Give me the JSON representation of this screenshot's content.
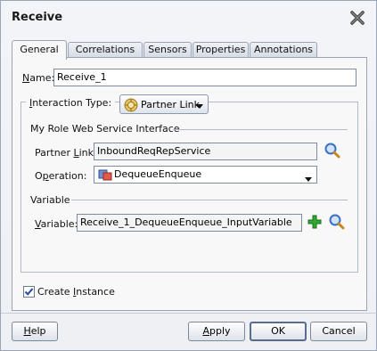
{
  "window": {
    "title": "Receive"
  },
  "tabs": [
    {
      "label": "General",
      "active": true
    },
    {
      "label": "Correlations"
    },
    {
      "label": "Sensors"
    },
    {
      "label": "Properties"
    },
    {
      "label": "Annotations"
    }
  ],
  "name": {
    "label_first": "N",
    "label_rest": "ame:",
    "value": "Receive_1"
  },
  "interaction": {
    "label_first": "I",
    "label_rest": "nteraction Type:",
    "value": "Partner Link",
    "icon": "partner-link-icon"
  },
  "role_section": {
    "title": "My Role Web Service Interface"
  },
  "partner_link": {
    "label_pre": "Partner ",
    "label_u": "L",
    "label_post": "ink:",
    "value": "InboundReqRepService"
  },
  "operation": {
    "label_pre": "O",
    "label_u": "p",
    "label_post": "eration:",
    "value": "DequeueEnqueue"
  },
  "variable_section": {
    "title": "Variable"
  },
  "variable": {
    "label_first": "V",
    "label_rest": "ariable:",
    "value": "Receive_1_DequeueEnqueue_InputVariable"
  },
  "create_instance": {
    "label_pre": "Create ",
    "label_u": "I",
    "label_post": "nstance",
    "checked": true
  },
  "buttons": {
    "help": {
      "u": "H",
      "rest": "elp"
    },
    "apply": {
      "u": "A",
      "rest": "pply"
    },
    "ok": "OK",
    "cancel": "Cancel"
  },
  "colors": {
    "border": "#9aa4b4",
    "add_green": "#2fa82f",
    "search_blue": "#3a6fc4",
    "check_blue": "#1f4aa8"
  }
}
